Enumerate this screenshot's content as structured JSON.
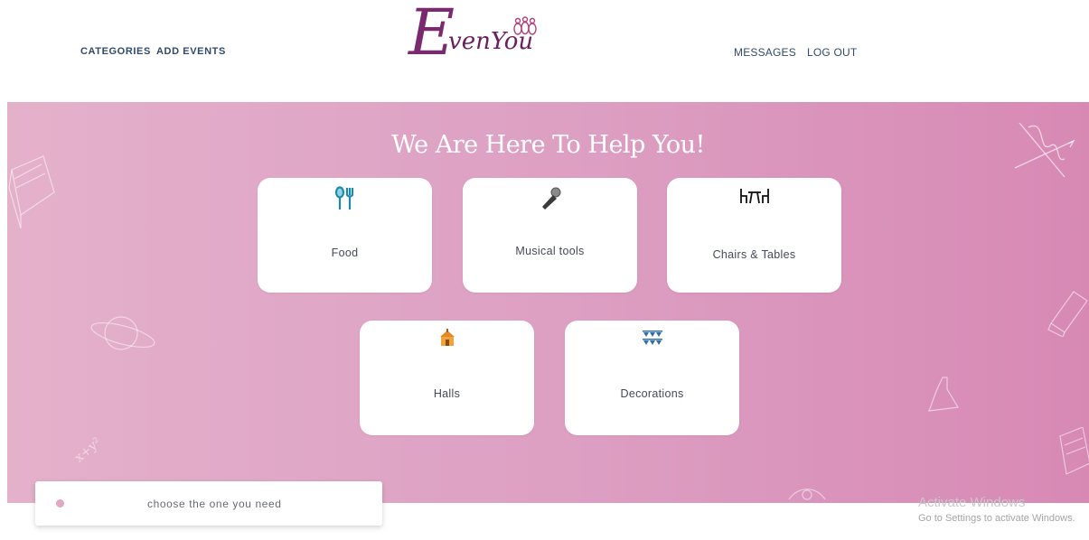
{
  "nav": {
    "categories": "CATEGORIES",
    "add_events": "ADD EVENTS",
    "messages": "MESSAGES",
    "logout": "LOG OUT"
  },
  "logo": {
    "text": "EvenYou",
    "initial": "E",
    "rest": "venYou",
    "color": "#6a1f5e"
  },
  "hero": {
    "title": "We Are Here To Help You!",
    "gradient": [
      "#e4b1cb",
      "#d789b4"
    ]
  },
  "categories": [
    {
      "label": "Food",
      "icon": "fork-spoon-icon"
    },
    {
      "label": "Musical tools",
      "icon": "microphone-icon"
    },
    {
      "label": "Chairs & Tables",
      "icon": "chairs-table-icon"
    },
    {
      "label": "Halls",
      "icon": "hall-icon"
    },
    {
      "label": "Decorations",
      "icon": "bunting-icon"
    }
  ],
  "toast": {
    "text": "choose the one you need",
    "dot_color": "#e2a6c6"
  },
  "watermark": {
    "title": "Activate Windows",
    "subtitle": "Go to Settings to activate Windows."
  }
}
